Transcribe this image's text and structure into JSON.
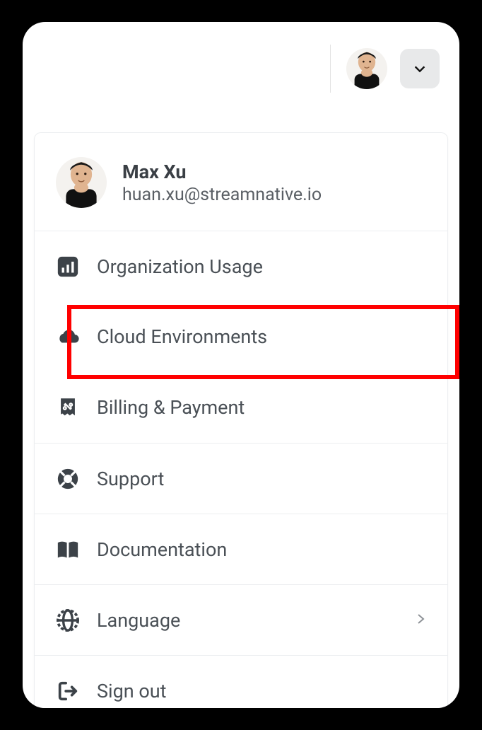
{
  "user": {
    "name": "Max Xu",
    "email": "huan.xu@streamnative.io"
  },
  "menu": {
    "org_usage": "Organization Usage",
    "cloud_env": "Cloud Environments",
    "billing": "Billing & Payment",
    "support": "Support",
    "docs": "Documentation",
    "language": "Language",
    "sign_out": "Sign out"
  },
  "highlighted": "cloud_env"
}
